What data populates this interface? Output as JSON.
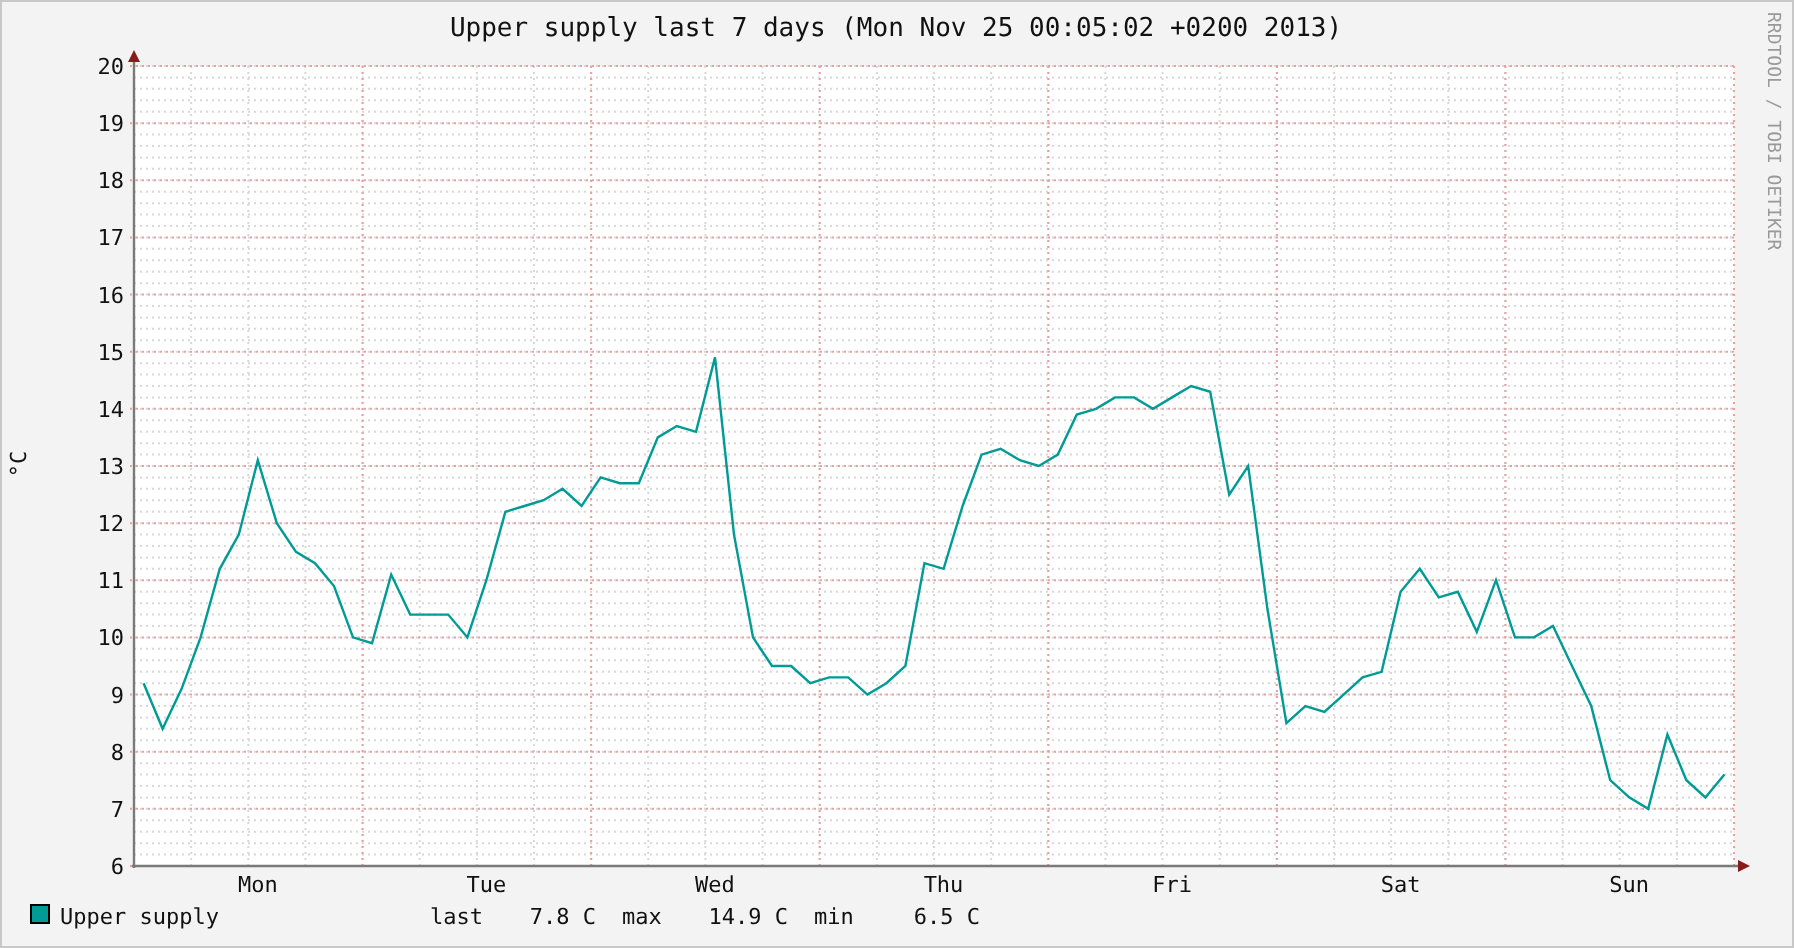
{
  "graph": {
    "chart_data": {
      "type": "line",
      "grid": true,
      "title": "Upper supply last 7 days (Mon Nov 25 00:05:02 +0200 2013)",
      "ylabel": "°C",
      "ylim": [
        6,
        20
      ],
      "categories": [
        null,
        null,
        null,
        null,
        null,
        null,
        "Mon",
        null,
        null,
        null,
        null,
        null,
        null,
        null,
        null,
        null,
        null,
        null,
        "Tue",
        null,
        null,
        null,
        null,
        null,
        null,
        null,
        null,
        null,
        null,
        null,
        "Wed",
        null,
        null,
        null,
        null,
        null,
        null,
        null,
        null,
        null,
        null,
        null,
        "Thu",
        null,
        null,
        null,
        null,
        null,
        null,
        null,
        null,
        null,
        null,
        null,
        "Fri",
        null,
        null,
        null,
        null,
        null,
        null,
        null,
        null,
        null,
        null,
        null,
        "Sat",
        null,
        null,
        null,
        null,
        null,
        null,
        null,
        null,
        null,
        null,
        null,
        "Sun",
        null,
        null,
        null,
        null,
        null
      ],
      "yticks": [
        6,
        7,
        8,
        9,
        10,
        11,
        12,
        13,
        14,
        15,
        16,
        17,
        18,
        19,
        20
      ],
      "series": [
        {
          "name": "Upper supply",
          "color": "#009b95",
          "values": [
            9.2,
            8.4,
            9.1,
            10.0,
            11.2,
            11.8,
            13.1,
            12.0,
            11.5,
            11.3,
            10.9,
            10.0,
            9.9,
            11.1,
            10.4,
            10.4,
            10.4,
            10.0,
            11.0,
            12.2,
            12.3,
            12.4,
            12.6,
            12.3,
            12.8,
            12.7,
            12.7,
            13.5,
            13.7,
            13.6,
            14.9,
            11.8,
            10.0,
            9.5,
            9.5,
            9.2,
            9.3,
            9.3,
            9.0,
            9.2,
            9.5,
            11.3,
            11.2,
            12.3,
            13.2,
            13.3,
            13.1,
            13.0,
            13.2,
            13.9,
            14.0,
            14.2,
            14.2,
            14.0,
            14.2,
            14.4,
            14.3,
            12.5,
            13.0,
            10.5,
            8.5,
            8.8,
            8.7,
            9.0,
            9.3,
            9.4,
            10.8,
            11.2,
            10.7,
            10.8,
            10.1,
            11.0,
            10.0,
            10.0,
            10.2,
            9.5,
            8.8,
            7.5,
            7.2,
            7.0,
            8.3,
            7.5,
            7.2,
            7.6
          ]
        }
      ]
    },
    "legend": {
      "stats": [
        {
          "label": "last",
          "value": "7.8 C"
        },
        {
          "label": "max",
          "value": "14.9 C"
        },
        {
          "label": "min",
          "value": "6.5 C"
        }
      ]
    },
    "credit": "RRDTOOL / TOBI OETIKER"
  }
}
